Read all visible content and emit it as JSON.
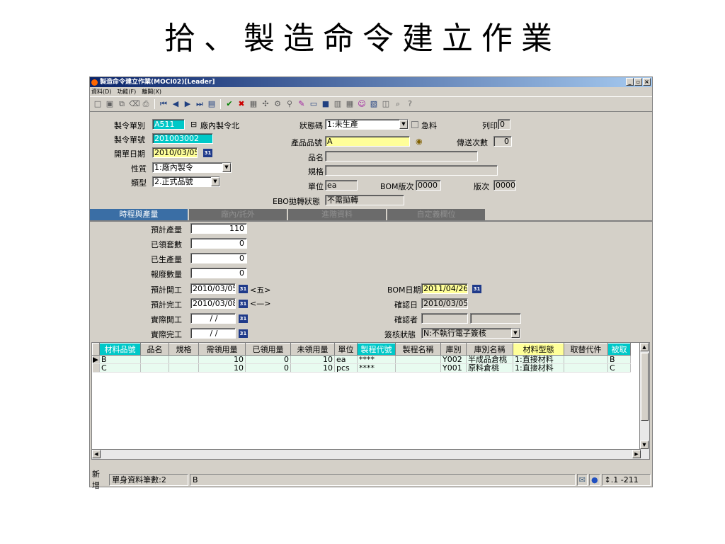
{
  "slide_title": "拾、製造命令建立作業",
  "window": {
    "title": "製造命令建立作業(MOCI02)[Leader]",
    "controls": [
      "_",
      "▫",
      "×"
    ]
  },
  "menu": [
    "資料(D)",
    "功能(F)",
    "離開(X)"
  ],
  "header": {
    "order_type_label": "製令單別",
    "order_type_value": "A511",
    "order_type_name": "廠內製令北",
    "order_no_label": "製令單號",
    "order_no_value": "201003002",
    "open_date_label": "開單日期",
    "open_date_value": "2010/03/05",
    "nature_label": "性質",
    "nature_value": "1:廠內製令",
    "kind_label": "類型",
    "kind_value": "2.正式品號",
    "status_code_label": "狀態碼",
    "status_code_value": "1:未生產",
    "urgent_label": "急料",
    "print_label": "列印",
    "print_value": "0",
    "product_no_label": "產品品號",
    "product_no_value": "A",
    "send_count_label": "傳送次數",
    "send_count_value": "0",
    "name_label": "品名",
    "name_value": "",
    "spec_label": "規格",
    "spec_value": "",
    "unit_label": "單位",
    "unit_value": "ea",
    "bom_version_label": "BOM版次",
    "bom_version_value": "0000",
    "version_label": "版次",
    "version_value": "0000",
    "ebo_label": "EBO拋轉狀態",
    "ebo_value": "不需拋轉"
  },
  "tabs": [
    "時程與產量",
    "廠內/託外",
    "進階資料",
    "自定義欄位"
  ],
  "schedule": {
    "planned_qty_label": "預計產量",
    "planned_qty_value": "110",
    "issued_sets_label": "已領套數",
    "issued_sets_value": "0",
    "produced_qty_label": "已生產量",
    "produced_qty_value": "0",
    "scrap_qty_label": "報廢數量",
    "scrap_qty_value": "0",
    "planned_start_label": "預計開工",
    "planned_start_value": "2010/03/05",
    "planned_start_weekday": "<五>",
    "planned_finish_label": "預計完工",
    "planned_finish_value": "2010/03/08",
    "planned_finish_weekday": "<—>",
    "actual_start_label": "實際開工",
    "actual_start_value": "/ /",
    "actual_finish_label": "實際完工",
    "actual_finish_value": "/ /",
    "bom_date_label": "BOM日期",
    "bom_date_value": "2011/04/26",
    "confirm_date_label": "確認日",
    "confirm_date_value": "2010/03/05",
    "confirmer_label": "確認者",
    "confirmer_value": "",
    "sign_status_label": "簽核狀態",
    "sign_status_value": "N:不執行電子簽核",
    "calendar_icon_text": "31"
  },
  "grid": {
    "columns": [
      "材料品號",
      "品名",
      "規格",
      "需領用量",
      "已領用量",
      "未領用量",
      "單位",
      "製程代號",
      "製程名稱",
      "庫別",
      "庫別名稱",
      "材料型態",
      "取替代件",
      "被取"
    ],
    "rows": [
      [
        "B",
        "",
        "",
        "10",
        "0",
        "10",
        "ea",
        "****",
        "",
        "Y002",
        "半成品倉桃",
        "1:直接材料",
        "",
        "B"
      ],
      [
        "C",
        "",
        "",
        "10",
        "0",
        "10",
        "pcs",
        "****",
        "",
        "Y001",
        "原料倉桃",
        "1:直接材料",
        "",
        "C"
      ]
    ]
  },
  "status_bar": {
    "mode": "新增",
    "record_count": "單身資料筆數:2",
    "current": "B",
    "code": "↕.1 -211"
  }
}
